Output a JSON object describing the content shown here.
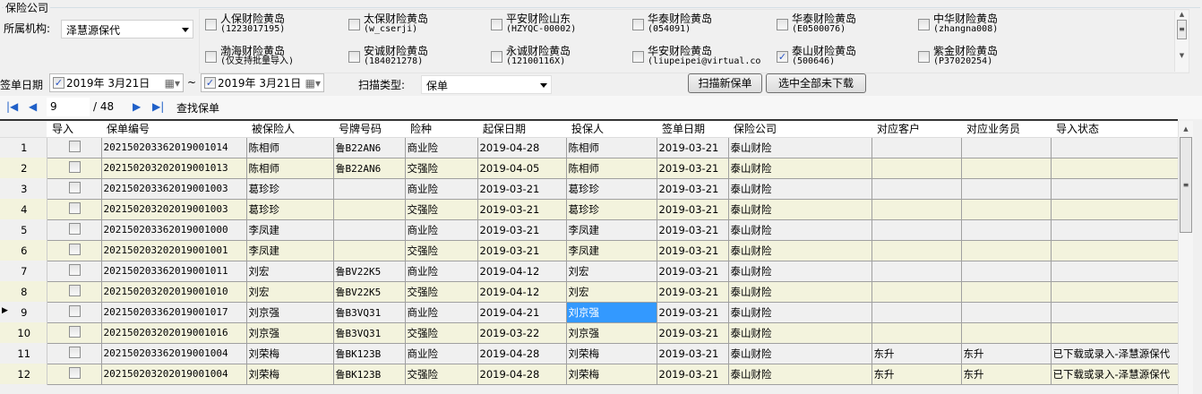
{
  "group_title": "保险公司",
  "org_label": "所属机构:",
  "org_value": "泽慧源保代",
  "insurers": [
    {
      "name": "人保财险黄岛",
      "code": "(1223017195)",
      "checked": false
    },
    {
      "name": "太保财险黄岛",
      "code": "(w_cserji)",
      "checked": false
    },
    {
      "name": "平安财险山东",
      "code": "(HZYQC-00002)",
      "checked": false
    },
    {
      "name": "华泰财险黄岛",
      "code": "(054091)",
      "checked": false
    },
    {
      "name": "华泰财险黄岛",
      "code": "(E0500076)",
      "checked": false
    },
    {
      "name": "中华财险黄岛",
      "code": "(zhangna008)",
      "checked": false
    },
    {
      "name": "渤海财险黄岛",
      "code": "(仅支持批量导入)",
      "checked": false
    },
    {
      "name": "安诚财险黄岛",
      "code": "(184021278)",
      "checked": false
    },
    {
      "name": "永诚财险黄岛",
      "code": "(12100116X)",
      "checked": false
    },
    {
      "name": "华安财险黄岛",
      "code": "(liupeipei@virtual.co",
      "checked": false
    },
    {
      "name": "泰山财险黄岛",
      "code": "(500646)",
      "checked": true
    },
    {
      "name": "紫金财险黄岛",
      "code": "(P37020254)",
      "checked": false
    }
  ],
  "date_label": "签单日期",
  "date_from": "2019年  3月21日",
  "date_to": "2019年  3月21日",
  "tilde": "~",
  "scan_type_label": "扫描类型:",
  "scan_type_value": "保单",
  "buttons": {
    "scan_new": "扫描新保单",
    "select_all": "选中全部未下载"
  },
  "nav": {
    "page": "9",
    "total": "/ 48",
    "find": "查找保单"
  },
  "columns": [
    "导入",
    "保单编号",
    "被保险人",
    "号牌号码",
    "险种",
    "起保日期",
    "投保人",
    "签单日期",
    "保险公司",
    "对应客户",
    "对应业务员",
    "导入状态"
  ],
  "rows": [
    [
      "1",
      "",
      "202150203362019001014",
      "陈相师",
      "鲁B22AN6",
      "商业险",
      "2019-04-28",
      "陈相师",
      "2019-03-21",
      "泰山财险",
      "",
      "",
      ""
    ],
    [
      "2",
      "",
      "202150203202019001013",
      "陈相师",
      "鲁B22AN6",
      "交强险",
      "2019-04-05",
      "陈相师",
      "2019-03-21",
      "泰山财险",
      "",
      "",
      ""
    ],
    [
      "3",
      "",
      "202150203362019001003",
      "葛珍珍",
      "",
      "商业险",
      "2019-03-21",
      "葛珍珍",
      "2019-03-21",
      "泰山财险",
      "",
      "",
      ""
    ],
    [
      "4",
      "",
      "202150203202019001003",
      "葛珍珍",
      "",
      "交强险",
      "2019-03-21",
      "葛珍珍",
      "2019-03-21",
      "泰山财险",
      "",
      "",
      ""
    ],
    [
      "5",
      "",
      "202150203362019001000",
      "李凤建",
      "",
      "商业险",
      "2019-03-21",
      "李凤建",
      "2019-03-21",
      "泰山财险",
      "",
      "",
      ""
    ],
    [
      "6",
      "",
      "202150203202019001001",
      "李凤建",
      "",
      "交强险",
      "2019-03-21",
      "李凤建",
      "2019-03-21",
      "泰山财险",
      "",
      "",
      ""
    ],
    [
      "7",
      "",
      "202150203362019001011",
      "刘宏",
      "鲁BV22K5",
      "商业险",
      "2019-04-12",
      "刘宏",
      "2019-03-21",
      "泰山财险",
      "",
      "",
      ""
    ],
    [
      "8",
      "",
      "202150203202019001010",
      "刘宏",
      "鲁BV22K5",
      "交强险",
      "2019-04-12",
      "刘宏",
      "2019-03-21",
      "泰山财险",
      "",
      "",
      ""
    ],
    [
      "9",
      "",
      "202150203362019001017",
      "刘京强",
      "鲁B3VQ31",
      "商业险",
      "2019-04-21",
      "刘京强",
      "2019-03-21",
      "泰山财险",
      "",
      "",
      ""
    ],
    [
      "10",
      "",
      "202150203202019001016",
      "刘京强",
      "鲁B3VQ31",
      "交强险",
      "2019-03-22",
      "刘京强",
      "2019-03-21",
      "泰山财险",
      "",
      "",
      ""
    ],
    [
      "11",
      "",
      "202150203362019001004",
      "刘荣梅",
      "鲁BK123B",
      "商业险",
      "2019-04-28",
      "刘荣梅",
      "2019-03-21",
      "泰山财险",
      "东升",
      "东升",
      "已下载或录入-泽慧源保代"
    ],
    [
      "12",
      "",
      "202150203202019001004",
      "刘荣梅",
      "鲁BK123B",
      "交强险",
      "2019-04-28",
      "刘荣梅",
      "2019-03-21",
      "泰山财险",
      "东升",
      "东升",
      "已下载或录入-泽慧源保代"
    ]
  ],
  "selected_row": 9,
  "selected_col": 7
}
